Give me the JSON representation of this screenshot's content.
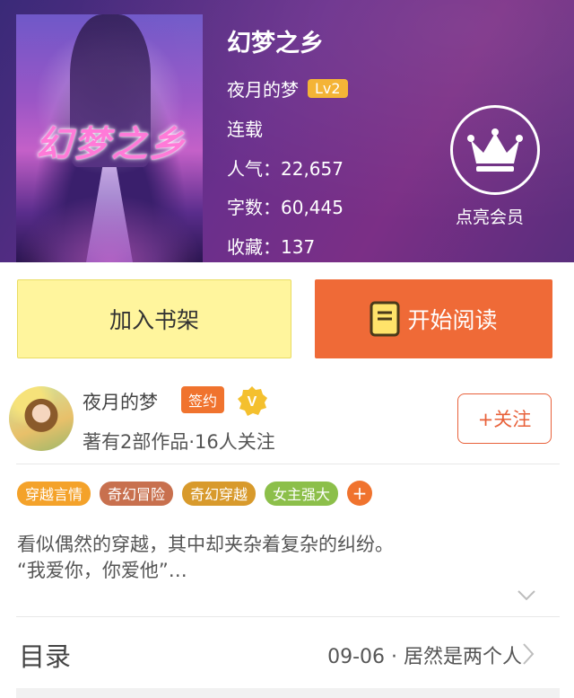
{
  "book": {
    "cover_text": "幻梦之乡",
    "title": "幻梦之乡",
    "author": "夜月的梦",
    "level": "Lv2",
    "status": "连载",
    "popularity": "人气：22,657",
    "words": "字数：60,445",
    "favorites": "收藏：137"
  },
  "vip": {
    "label": "点亮会员",
    "icon": "crown-icon"
  },
  "actions": {
    "shelf_label": "加入书架",
    "read_label": "开始阅读"
  },
  "author_card": {
    "name": "夜月的梦",
    "sign_badge": "签约",
    "stats": "著有2部作品·16人关注",
    "follow_label": "+关注"
  },
  "tags": [
    {
      "label": "穿越言情",
      "color": "#f4a22a"
    },
    {
      "label": "奇幻冒险",
      "color": "#c8704e"
    },
    {
      "label": "奇幻穿越",
      "color": "#d89a2c"
    },
    {
      "label": "女主强大",
      "color": "#8cbf4a"
    }
  ],
  "tag_more": "+",
  "description": {
    "line1": "看似偶然的穿越，其中却夹杂着复杂的纠纷。",
    "line2": "“我爱你，你爱他”…"
  },
  "toc": {
    "label": "目录",
    "latest": "09-06 · 居然是两个人"
  },
  "colors": {
    "accent_orange": "#ef6a37",
    "shelf_yellow": "#fff59d",
    "header_purple": "#6a2f8c"
  }
}
